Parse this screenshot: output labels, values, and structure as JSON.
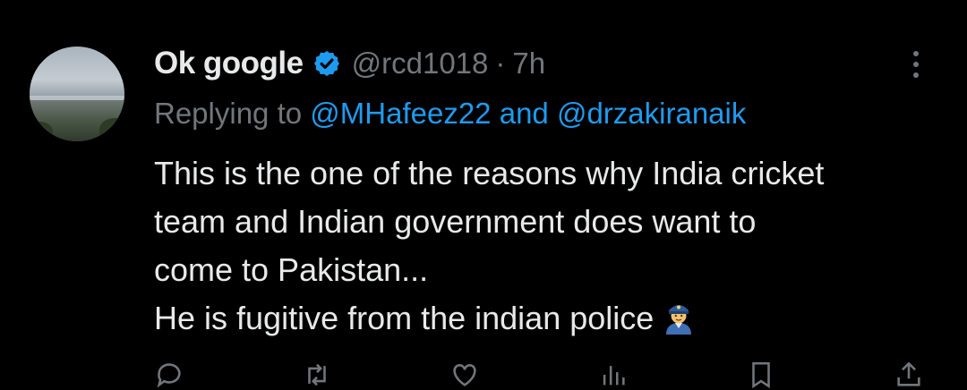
{
  "tweet": {
    "author_name": "Ok google",
    "handle": "@rcd1018",
    "separator": "·",
    "time": "7h",
    "replying_prefix": "Replying to",
    "reply_mentions": [
      "@MHafeez22",
      "@drzakiranaik"
    ],
    "reply_joiner": "and",
    "body_lines": [
      "This is the one of the reasons why India cricket",
      "team and Indian government does want to",
      "come to Pakistan...",
      "He is fugitive from the indian police"
    ],
    "emoji": "police-officer-emoji"
  },
  "icons": {
    "verified": "verified-badge-icon",
    "more": "more-options-icon",
    "reply": "reply-icon",
    "retweet": "retweet-icon",
    "like": "like-icon",
    "views": "views-icon",
    "bookmark": "bookmark-icon",
    "share": "share-icon"
  },
  "colors": {
    "background": "#000000",
    "text": "#e7e9ea",
    "secondary": "#71767b",
    "accent": "#1d9bf0"
  }
}
